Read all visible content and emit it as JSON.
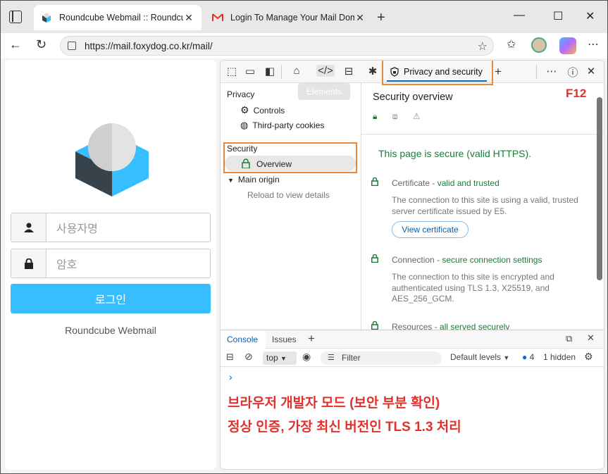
{
  "browser": {
    "tabs": [
      {
        "title": "Roundcube Webmail :: Roundcube",
        "active": true
      },
      {
        "title": "Login To Manage Your Mail Doma",
        "active": false
      }
    ],
    "url": "https://mail.foxydog.co.kr/mail/"
  },
  "webmail": {
    "username_placeholder": "사용자명",
    "password_placeholder": "암호",
    "login_label": "로그인",
    "brand": "Roundcube Webmail",
    "colors": {
      "accent": "#37beff",
      "logo_dark": "#37424a",
      "logo_light": "#37beff"
    }
  },
  "devtools": {
    "active_tab": "Privacy and security",
    "tooltip": "Elements",
    "f12_label": "F12",
    "sidebar": {
      "privacy_heading": "Privacy",
      "controls": "Controls",
      "third_party": "Third-party cookies",
      "security_heading": "Security",
      "overview": "Overview",
      "main_origin": "Main origin",
      "reload_hint": "Reload to view details"
    },
    "overview": {
      "title": "Security overview",
      "secure_message": "This page is secure (valid HTTPS).",
      "certificate_label": "Certificate - ",
      "certificate_status": "valid and trusted",
      "certificate_desc": "The connection to this site is using a valid, trusted server certificate issued by E5.",
      "view_certificate": "View certificate",
      "connection_label": "Connection - ",
      "connection_status": "secure connection settings",
      "connection_desc": "The connection to this site is encrypted and authenticated using TLS 1.3, X25519, and AES_256_GCM.",
      "resources_label": "Resources - ",
      "resources_status": "all served securely"
    },
    "drawer": {
      "tabs": [
        "Console",
        "Issues"
      ],
      "context": "top",
      "filter_placeholder": "Filter",
      "levels": "Default levels",
      "issues_count": "4",
      "hidden": "1 hidden",
      "prompt": "›"
    },
    "annotations": {
      "line1": "브라우저 개발자 모드 (보안 부분 확인)",
      "line2": "정상 인증, 가장 최신 버전인 TLS 1.3 처리"
    },
    "colors": {
      "highlight": "#e8883a",
      "secure_green": "#1c7c3a",
      "note_red": "#e0312d"
    }
  }
}
